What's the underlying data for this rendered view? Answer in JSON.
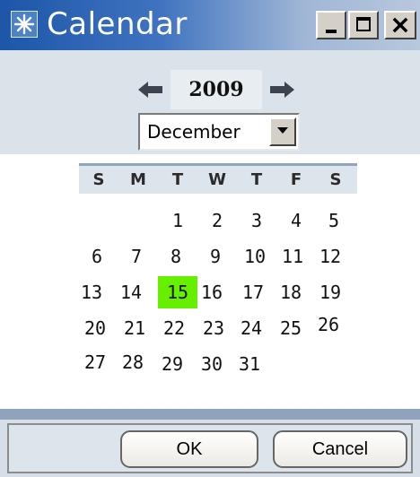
{
  "window": {
    "title": "Calendar"
  },
  "navigation": {
    "year": "2009",
    "month": "December"
  },
  "weekdays": [
    "S",
    "M",
    "T",
    "W",
    "T",
    "F",
    "S"
  ],
  "weeks": [
    [
      "",
      "",
      "1",
      "2",
      "3",
      "4",
      "5"
    ],
    [
      "6",
      "7",
      "8",
      "9",
      "10",
      "11",
      "12"
    ],
    [
      "13",
      "14",
      "15",
      "16",
      "17",
      "18",
      "19"
    ],
    [
      "20",
      "21",
      "22",
      "23",
      "24",
      "25",
      "26"
    ],
    [
      "27",
      "28",
      "29",
      "30",
      "31",
      "",
      ""
    ]
  ],
  "selected_day": "15",
  "buttons": {
    "ok": "OK",
    "cancel": "Cancel"
  },
  "colors": {
    "title_bar_start": "#1d56a8",
    "selected_day": "#66f000",
    "header_panel": "#dbe3ea"
  },
  "icons": {
    "app": "calendar-app-icon",
    "prev_year": "left-arrow-icon",
    "next_year": "right-arrow-icon",
    "dropdown": "triangle-down-icon",
    "minimize": "minimize-icon",
    "maximize": "maximize-icon",
    "close": "close-icon"
  }
}
